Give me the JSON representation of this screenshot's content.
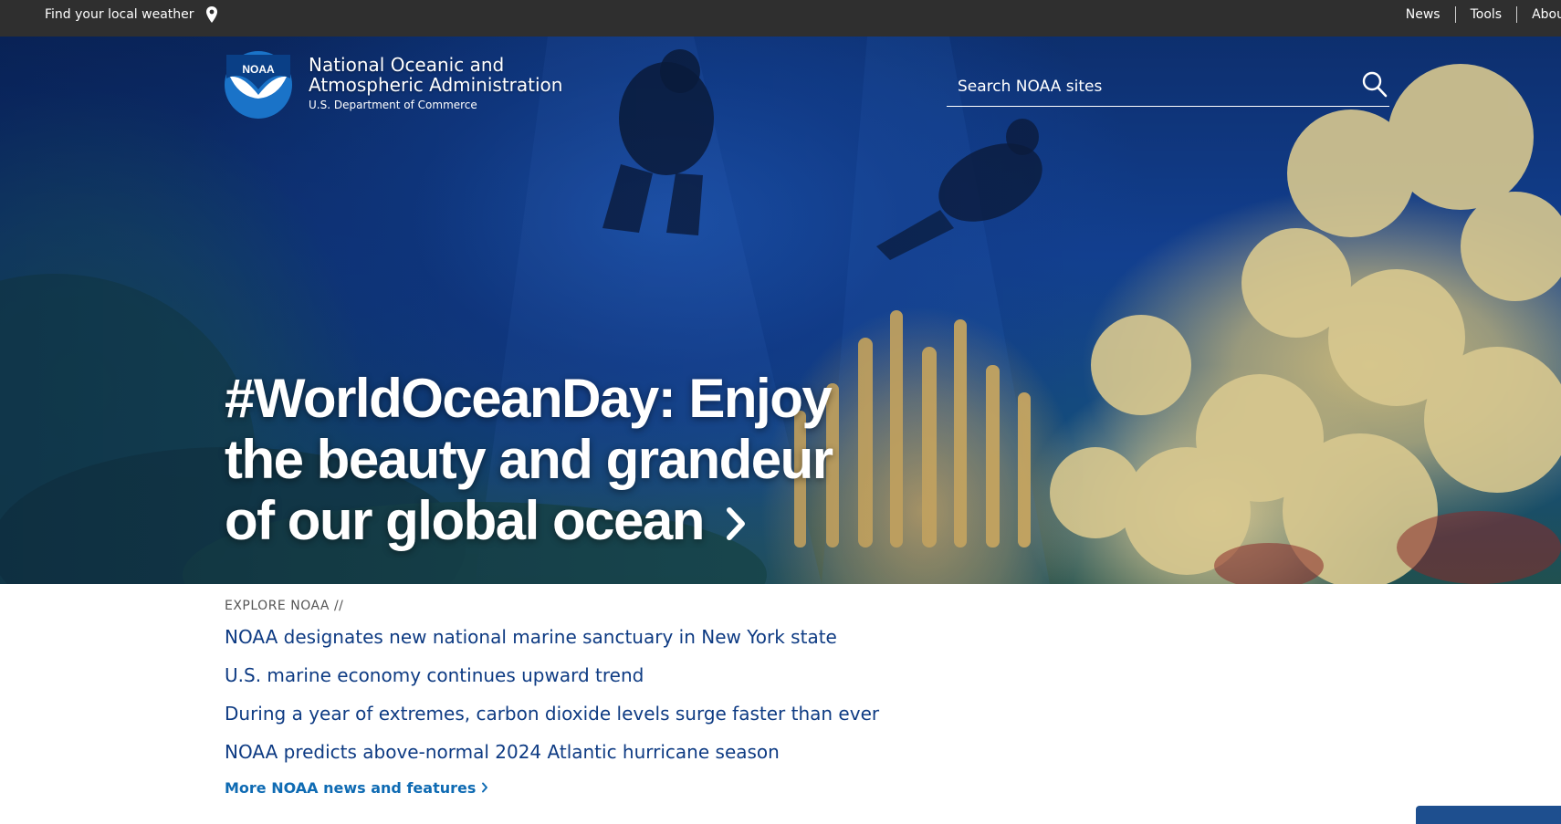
{
  "topbar": {
    "weather_label": "Find your local weather",
    "pin_icon": "location-pin-icon",
    "nav": [
      "News",
      "Tools",
      "Abou"
    ]
  },
  "brand": {
    "logo_text": "NOAA",
    "line1": "National Oceanic and",
    "line2": "Atmospheric Administration",
    "dept": "U.S. Department of Commerce"
  },
  "search": {
    "placeholder": "Search NOAA sites",
    "icon": "search-icon"
  },
  "hero": {
    "headline": "#WorldOceanDay: Enjoy the beauty and grandeur of our global ocean",
    "chevron_icon": "chevron-right-icon"
  },
  "explore": {
    "eyebrow": "EXPLORE NOAA //",
    "items": [
      "NOAA designates new national marine sanctuary in New York state",
      "U.S. marine economy continues upward trend",
      "During a year of extremes, carbon dioxide levels surge faster than ever",
      "NOAA predicts above-normal 2024 Atlantic hurricane season"
    ],
    "more_label": "More NOAA news and features"
  },
  "colors": {
    "topbar_bg": "#2f2f2f",
    "link": "#0e3b83",
    "more_link": "#0f6bb3",
    "noaa_blue": "#1a73c8"
  }
}
